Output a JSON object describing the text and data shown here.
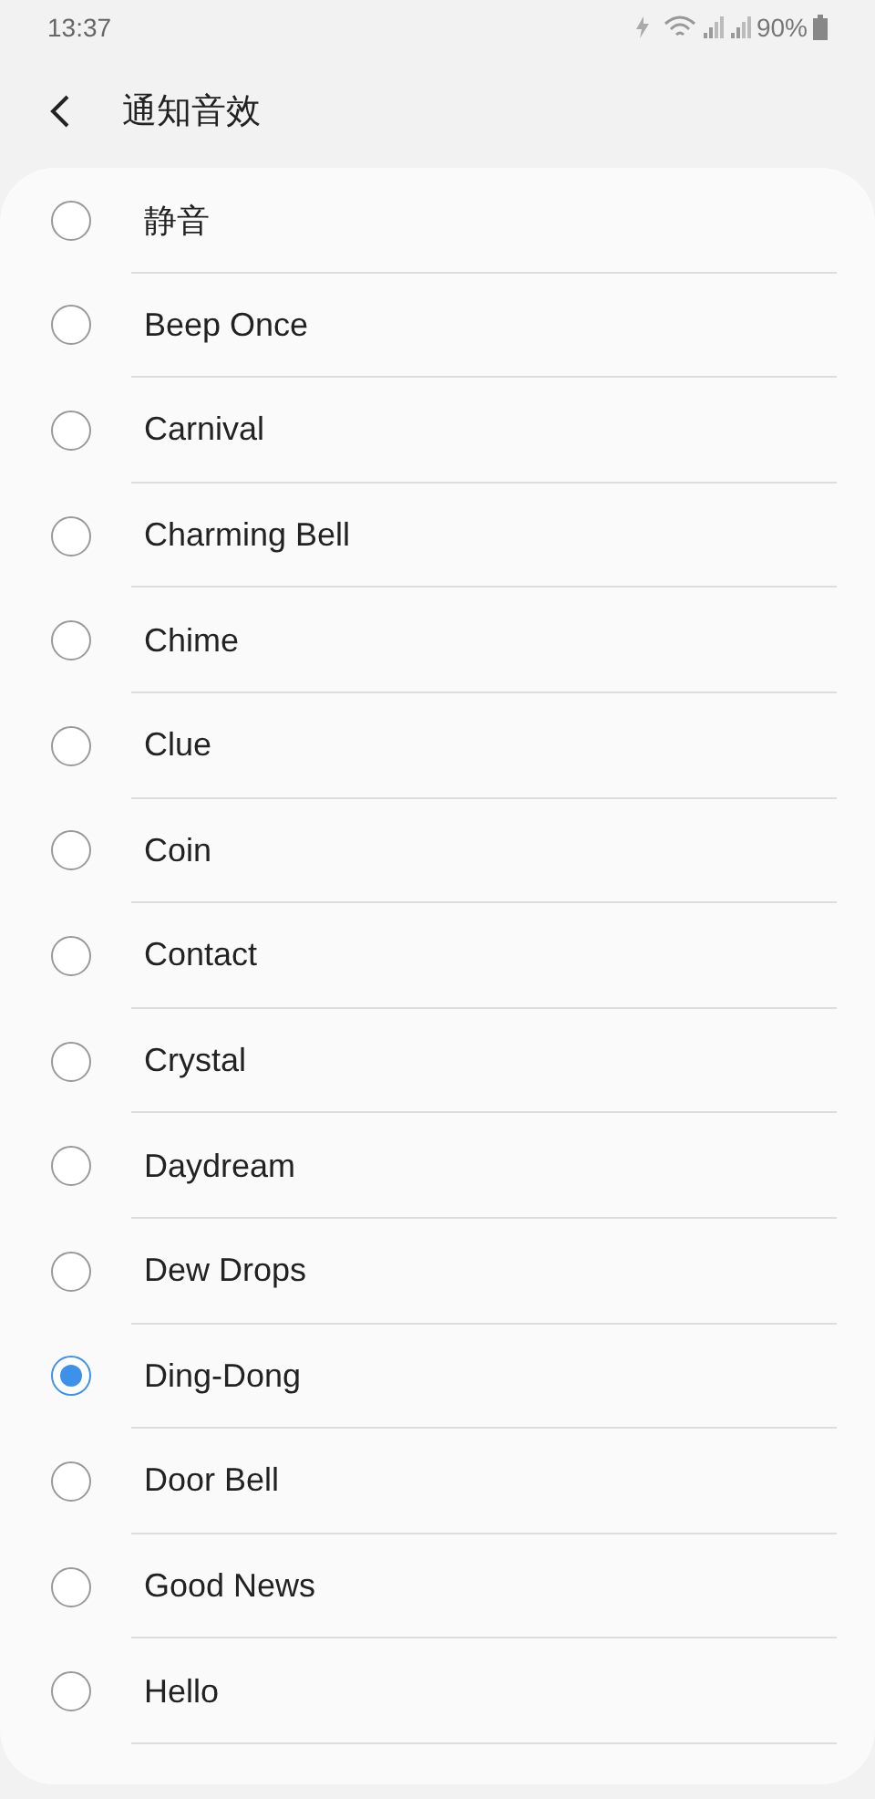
{
  "status_bar": {
    "time": "13:37",
    "battery": "90%"
  },
  "header": {
    "title": "通知音效"
  },
  "sounds": [
    {
      "label": "静音",
      "selected": false
    },
    {
      "label": "Beep Once",
      "selected": false
    },
    {
      "label": "Carnival",
      "selected": false
    },
    {
      "label": "Charming Bell",
      "selected": false
    },
    {
      "label": "Chime",
      "selected": false
    },
    {
      "label": "Clue",
      "selected": false
    },
    {
      "label": "Coin",
      "selected": false
    },
    {
      "label": "Contact",
      "selected": false
    },
    {
      "label": "Crystal",
      "selected": false
    },
    {
      "label": "Daydream",
      "selected": false
    },
    {
      "label": "Dew Drops",
      "selected": false
    },
    {
      "label": "Ding-Dong",
      "selected": true
    },
    {
      "label": "Door Bell",
      "selected": false
    },
    {
      "label": "Good News",
      "selected": false
    },
    {
      "label": "Hello",
      "selected": false
    }
  ]
}
